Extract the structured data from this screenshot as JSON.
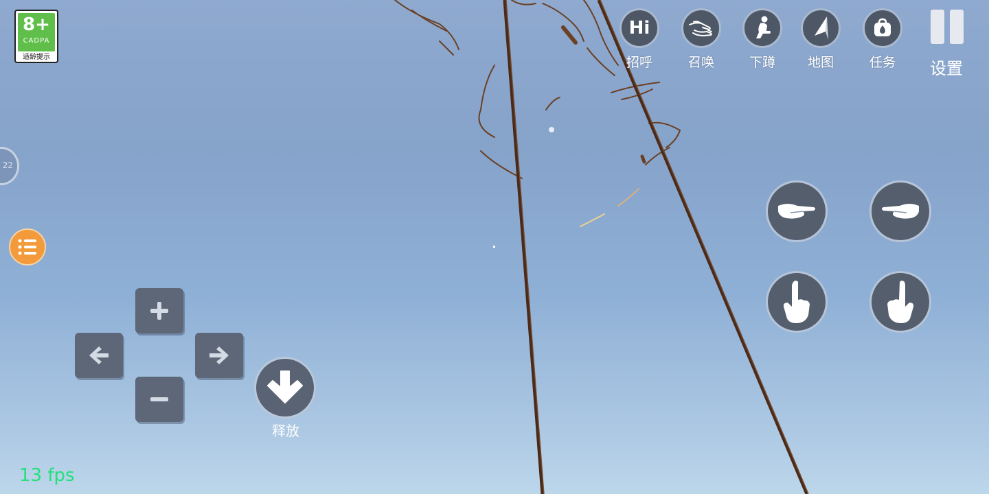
{
  "age_rating": {
    "rating": "8+",
    "org": "CADPA",
    "caption": "适龄提示"
  },
  "top_menu": [
    {
      "id": "greet",
      "label": "招呼",
      "icon": "hi-icon",
      "icon_text": "Hi"
    },
    {
      "id": "summon",
      "label": "召唤",
      "icon": "beckon-hand-icon"
    },
    {
      "id": "crouch",
      "label": "下蹲",
      "icon": "crouch-figure-icon"
    },
    {
      "id": "map",
      "label": "地图",
      "icon": "navigation-arrow-icon"
    },
    {
      "id": "tasks",
      "label": "任务",
      "icon": "bag-icon"
    }
  ],
  "settings": {
    "label": "设置",
    "icon": "pause-icon"
  },
  "left_edge": {
    "dial_text": "22",
    "menu_icon": "list-icon"
  },
  "dpad": {
    "up": {
      "icon": "plus-icon"
    },
    "left": {
      "icon": "arrow-left-icon"
    },
    "right": {
      "icon": "arrow-right-icon"
    },
    "down": {
      "icon": "minus-icon"
    }
  },
  "release": {
    "label": "释放",
    "icon": "arrow-down-icon"
  },
  "hand_buttons": [
    {
      "id": "left-grab",
      "icon": "open-palm-icon"
    },
    {
      "id": "right-grab",
      "icon": "open-palm-icon"
    },
    {
      "id": "left-point",
      "icon": "pointing-hand-icon"
    },
    {
      "id": "right-point",
      "icon": "pointing-hand-icon"
    }
  ],
  "fps": {
    "text": "13 fps"
  },
  "colors": {
    "sky_top": "#8fa9cf",
    "button_fill": "#4e5766",
    "button_ring": "#a9b9cf",
    "menu_orange": "#f39a3a",
    "fps_green": "#22e07a"
  }
}
